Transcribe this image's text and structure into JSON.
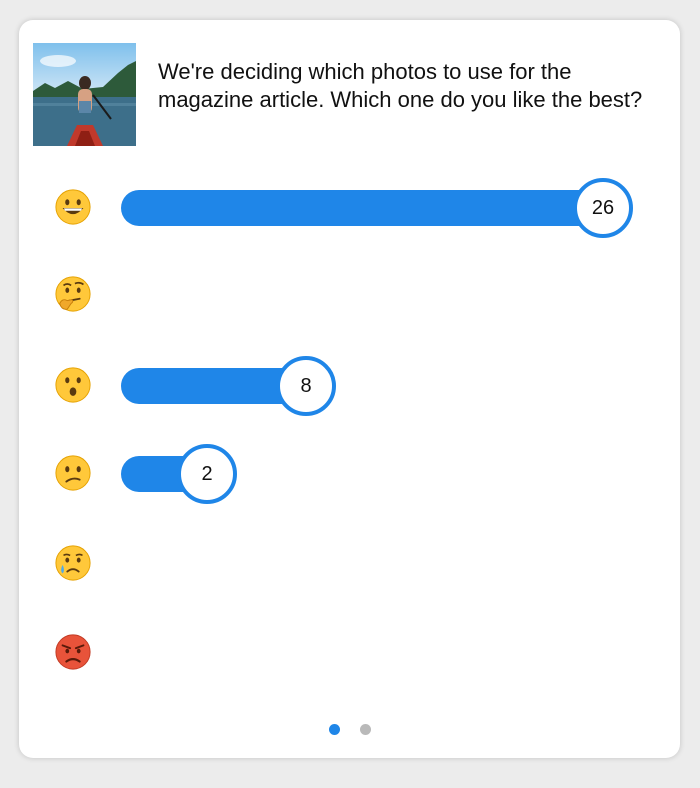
{
  "poll": {
    "question": "We're deciding which photos to use for the magazine article. Which one do you like the best?",
    "max_votes": 26,
    "options": [
      {
        "emoji": "grinning-face",
        "votes": 26
      },
      {
        "emoji": "thinking-face",
        "votes": 0
      },
      {
        "emoji": "hushed-face",
        "votes": 8
      },
      {
        "emoji": "confused-face",
        "votes": 2
      },
      {
        "emoji": "crying-face",
        "votes": 0
      },
      {
        "emoji": "angry-face",
        "votes": 0
      }
    ]
  },
  "counts": {
    "o0": "26",
    "o2": "8",
    "o3": "2"
  },
  "pager": {
    "current_page": 1,
    "total_pages": 2
  },
  "colors": {
    "accent": "#1f86e8",
    "inactive_dot": "#b9b9b9"
  }
}
